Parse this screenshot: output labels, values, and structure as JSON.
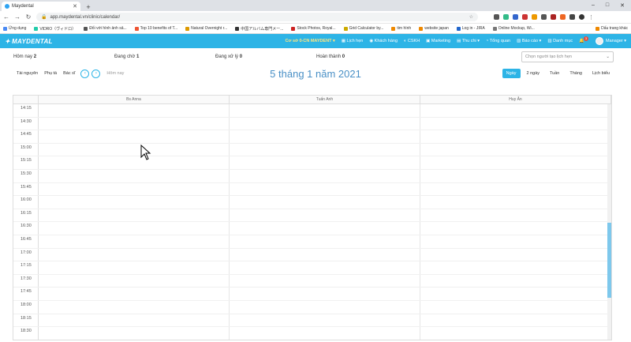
{
  "browser": {
    "tab_title": "Maydental",
    "new_tab": "+",
    "url": "app.maydental.vn/clinic/calendar/",
    "bookmarks": [
      "Ứng dụng",
      "VIDRO（ヴィドロ）",
      "Đối với hình ảnh sả...",
      "Top 10 benefits of T...",
      "Natural Overnight r...",
      "中国アルバム専門メー...",
      "Stock Photos, Royal...",
      "Grid Calculator by...",
      "tim hình",
      "website japan",
      "Log in - JIRA",
      "Online Mockup, Wi...",
      "Dấu trang khác"
    ],
    "window_controls": [
      "–",
      "□",
      "✕"
    ]
  },
  "app": {
    "logo": "MAYDENTAL",
    "menu": {
      "branch": "Cơ sở 0-CN MAYDENT ▾",
      "items": [
        "Lịch hẹn",
        "Khách hàng",
        "CSKH",
        "Marketing",
        "Thu chi ▾",
        "Tổng quan",
        "Báo cáo ▾",
        "Danh mục"
      ],
      "notif_count": "3",
      "user": "Manager ▾"
    }
  },
  "stats": {
    "today_label": "Hôm nay",
    "today_val": "2",
    "waiting_label": "Đang chờ",
    "waiting_val": "1",
    "processing_label": "Đang xử lý",
    "processing_val": "0",
    "done_label": "Hoàn thành",
    "done_val": "0",
    "select_placeholder": "Chọn người tạo lịch hẹn"
  },
  "toolbar": {
    "resource": "Tài nguyên",
    "assistant": "Phụ tá",
    "doctor": "Bác sĩ",
    "prev": "‹",
    "next": "›",
    "today": "Hôm nay",
    "title": "5 tháng 1 năm 2021",
    "views": [
      "Ngày",
      "2 ngày",
      "Tuần",
      "Tháng",
      "Lịch biểu"
    ]
  },
  "calendar": {
    "columns": [
      "Bs Anna",
      "Tuấn Anh",
      "Huy Ân"
    ],
    "times": [
      "14:15",
      "14:30",
      "14:45",
      "15:00",
      "15:15",
      "15:30",
      "15:45",
      "16:00",
      "16:15",
      "16:30",
      "16:45",
      "17:00",
      "17:15",
      "17:30",
      "17:45",
      "18:00",
      "18:15",
      "18:30"
    ]
  },
  "colors": {
    "brand": "#2db4e6",
    "title": "#4a90c6"
  }
}
